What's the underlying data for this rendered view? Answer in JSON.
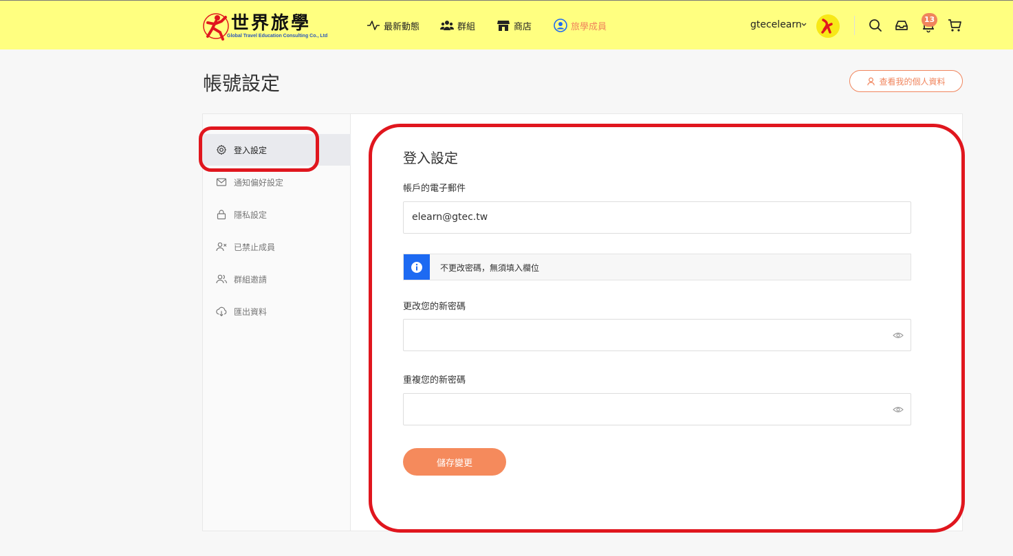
{
  "header": {
    "logo": {
      "title": "世界旅學",
      "subtitle": "Global Travel Education Consulting Co., Ltd"
    },
    "nav": [
      {
        "label": "最新動態",
        "icon": "activity-icon"
      },
      {
        "label": "群組",
        "icon": "users-icon"
      },
      {
        "label": "商店",
        "icon": "store-icon"
      },
      {
        "label": "旅學成員",
        "icon": "member-icon"
      }
    ],
    "username": "gtecelearn",
    "notification_count": "13",
    "colors": {
      "bar": "#ffff80",
      "accent": "#f0845c",
      "active_nav": "#f0845c"
    }
  },
  "page": {
    "title": "帳號設定",
    "profile_button": "查看我的個人資料"
  },
  "sidebar": {
    "items": [
      {
        "label": "登入設定",
        "icon": "gear-icon",
        "active": true
      },
      {
        "label": "通知偏好設定",
        "icon": "mail-icon"
      },
      {
        "label": "隱私設定",
        "icon": "lock-icon"
      },
      {
        "label": "已禁止成員",
        "icon": "user-x-icon"
      },
      {
        "label": "群組邀請",
        "icon": "users-icon"
      },
      {
        "label": "匯出資料",
        "icon": "cloud-download-icon"
      }
    ]
  },
  "form": {
    "section_title": "登入設定",
    "email_label": "帳戶的電子郵件",
    "email_value": "elearn@gtec.tw",
    "notice": "不更改密碼，無須填入欄位",
    "new_password_label": "更改您的新密碼",
    "new_password_value": "",
    "repeat_password_label": "重複您的新密碼",
    "repeat_password_value": "",
    "save_button": "儲存變更"
  }
}
